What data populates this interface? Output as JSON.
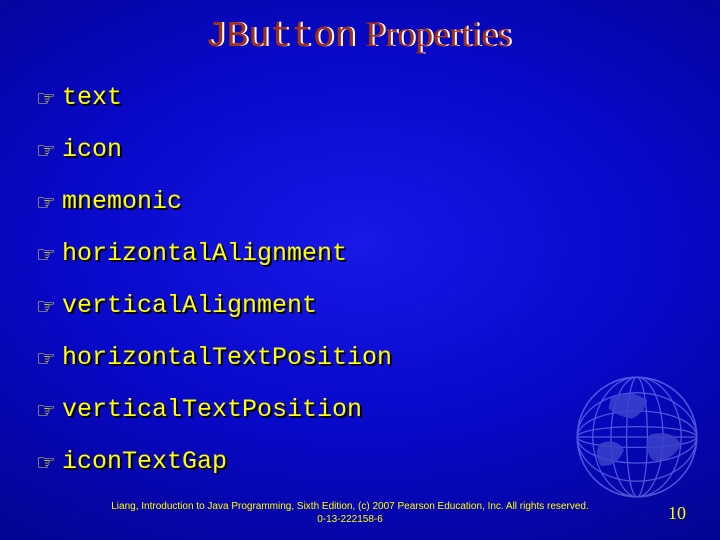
{
  "title": {
    "mono": "JButton",
    "serif": " Properties"
  },
  "properties": [
    "text",
    "icon",
    "mnemonic",
    "horizontalAlignment",
    "verticalAlignment",
    "horizontalTextPosition",
    "verticalTextPosition",
    "iconTextGap"
  ],
  "footer": "Liang, Introduction to Java Programming, Sixth Edition, (c) 2007 Pearson Education, Inc. All rights reserved. 0-13-222158-6",
  "page_number": "10",
  "bullet_glyph": "☞"
}
